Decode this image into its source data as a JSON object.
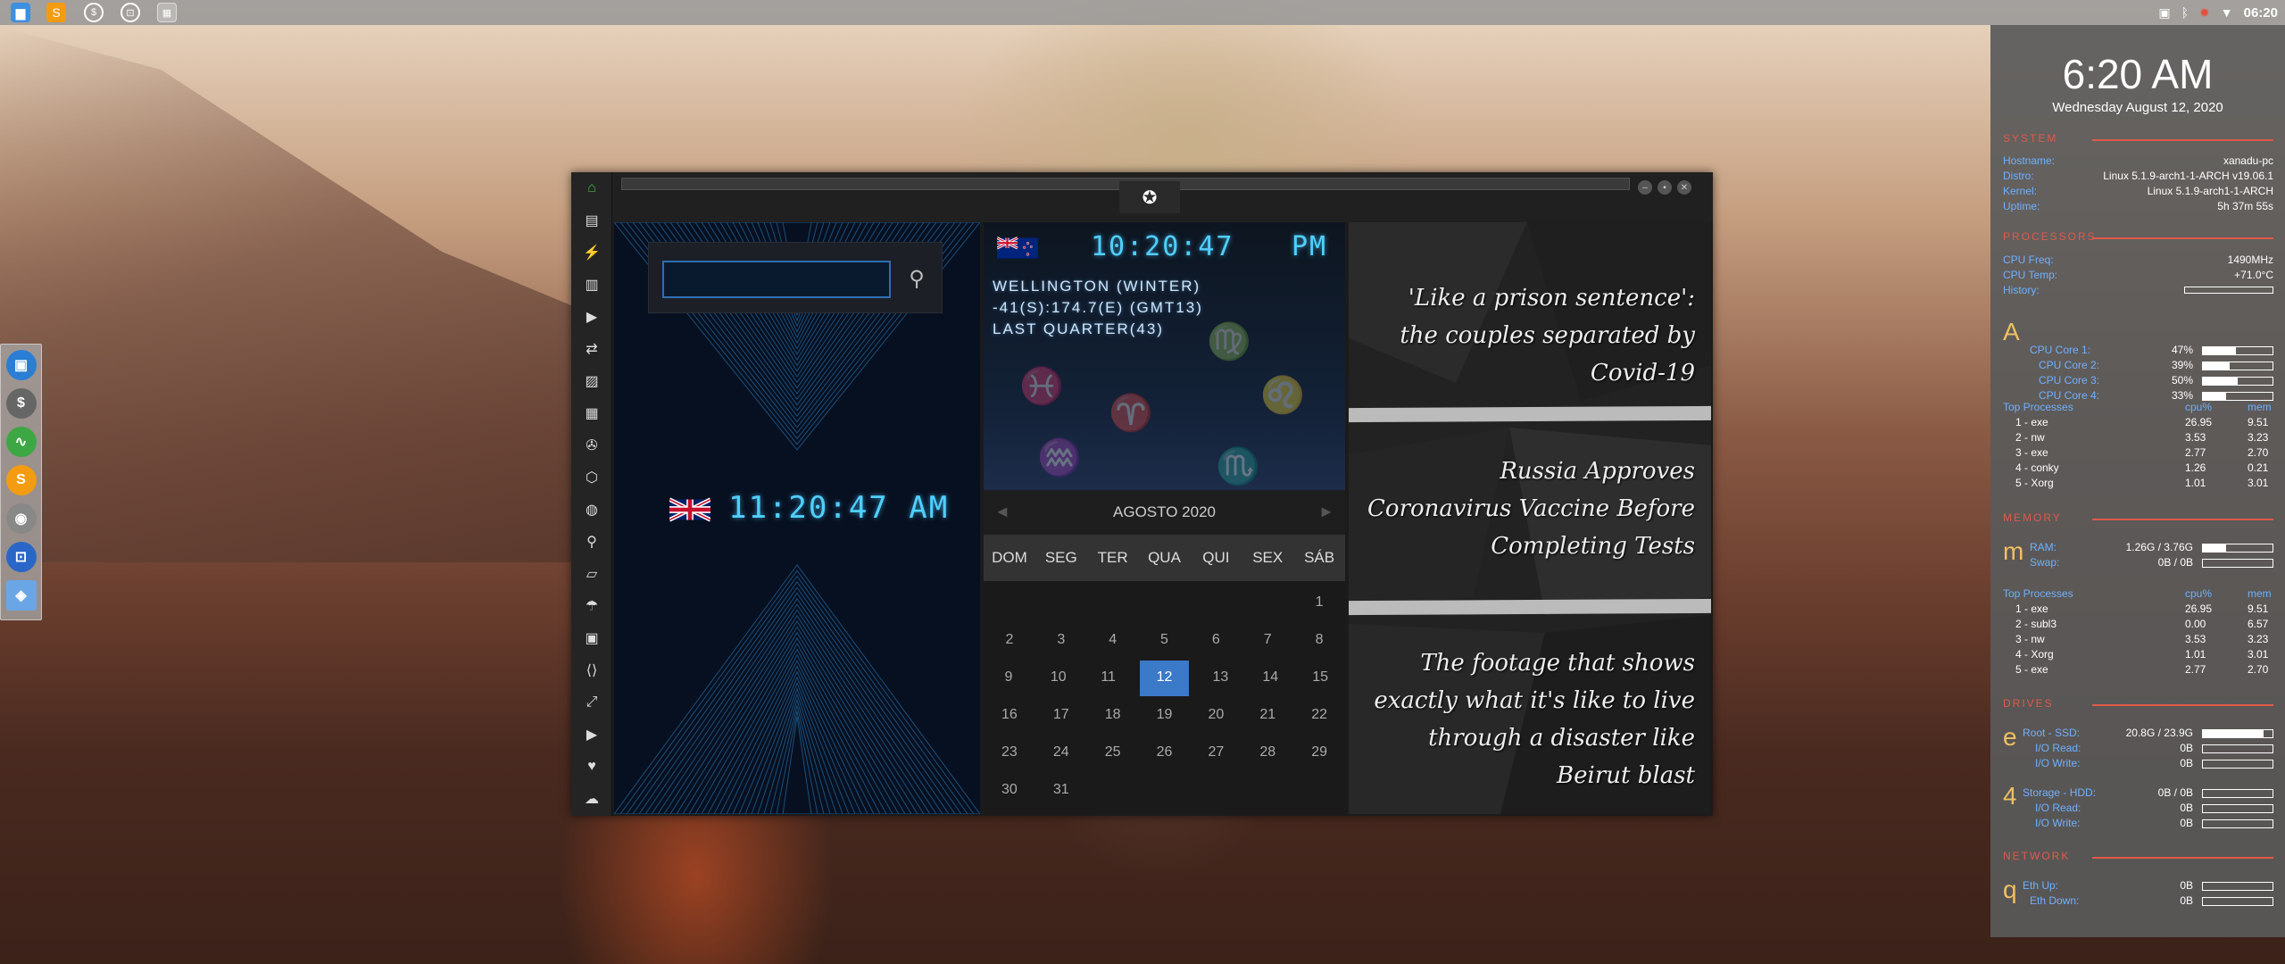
{
  "taskbar": {
    "clock": "06:20",
    "launchers": [
      "folder-icon",
      "sublime-icon",
      "money-icon",
      "remote-icon",
      "browser-thumb-icon"
    ],
    "tray_icons": [
      "photo-icon",
      "bluetooth-icon",
      "network-error-icon",
      "wifi-icon"
    ]
  },
  "dock": {
    "items": [
      {
        "name": "files-dock-icon",
        "glyph": "▣",
        "color": "#2a7fd4"
      },
      {
        "name": "money-dock-icon",
        "glyph": "$",
        "color": "#666"
      },
      {
        "name": "monitor-dock-icon",
        "glyph": "∿",
        "color": "#3da843"
      },
      {
        "name": "sublime-dock-icon",
        "glyph": "S",
        "color": "#f39c12"
      },
      {
        "name": "chrome-dock-icon",
        "glyph": "◉",
        "color": "#888"
      },
      {
        "name": "remote-dock-icon",
        "glyph": "⊡",
        "color": "#2a66c8"
      },
      {
        "name": "web-dock-icon",
        "glyph": "◈",
        "color": "#6aa6e6"
      }
    ]
  },
  "sidebar": {
    "items": [
      "home-icon",
      "document-icon",
      "lightning-icon",
      "archive-icon",
      "play-icon",
      "translate-icon",
      "image-icon",
      "news-icon",
      "aperture-icon",
      "hexagon-icon",
      "globe-icon",
      "search-icon",
      "map-icon",
      "umbrella-icon",
      "contact-icon",
      "code-icon",
      "expand-icon",
      "youtube-icon",
      "heart-icon",
      "cloud-icon"
    ]
  },
  "world_clock": {
    "uk_time": "11:20:47 AM",
    "nz_time": "10:20:47",
    "nz_ampm": "PM",
    "nz_city": "WELLINGTON (WINTER)",
    "nz_coords": "-41(S):174.7(E) (GMT13)",
    "nz_moon": "LAST QUARTER(43)"
  },
  "calendar": {
    "month_title": "AGOSTO 2020",
    "days_of_week": [
      "DOM",
      "SEG",
      "TER",
      "QUA",
      "QUI",
      "SEX",
      "SÁB"
    ],
    "weeks": [
      [
        "",
        "",
        "",
        "",
        "",
        "",
        "1"
      ],
      [
        "2",
        "3",
        "4",
        "5",
        "6",
        "7",
        "8"
      ],
      [
        "9",
        "10",
        "11",
        "12",
        "13",
        "14",
        "15"
      ],
      [
        "16",
        "17",
        "18",
        "19",
        "20",
        "21",
        "22"
      ],
      [
        "23",
        "24",
        "25",
        "26",
        "27",
        "28",
        "29"
      ],
      [
        "30",
        "31",
        "",
        "",
        "",
        "",
        ""
      ]
    ],
    "today": "12"
  },
  "news": [
    "'Like a prison sentence': the couples separated by Covid-19",
    "Russia Approves Coronavirus Vaccine Before Completing Tests",
    "The footage that shows exactly what it's like to live through a disaster like Beirut blast"
  ],
  "conky": {
    "time": "6:20 AM",
    "date": "Wednesday August 12, 2020",
    "system_title": "SYSTEM",
    "hostname_label": "Hostname:",
    "hostname": "xanadu-pc",
    "distro_label": "Distro:",
    "distro": "Linux 5.1.9-arch1-1-ARCH v19.06.1",
    "kernel_label": "Kernel:",
    "kernel": "Linux 5.1.9-arch1-1-ARCH",
    "uptime_label": "Uptime:",
    "uptime": "5h 37m 55s",
    "proc_title": "PROCESSORS",
    "cpu_freq_label": "CPU Freq:",
    "cpu_freq": "1490MHz",
    "cpu_temp_label": "CPU Temp:",
    "cpu_temp": "+71.0°C",
    "history_label": "History:",
    "cpu_glyph": "A",
    "cores": [
      {
        "label": "CPU Core 1:",
        "value": "47%",
        "pct": 0.47
      },
      {
        "label": "CPU Core 2:",
        "value": "39%",
        "pct": 0.39
      },
      {
        "label": "CPU Core 3:",
        "value": "50%",
        "pct": 0.5
      },
      {
        "label": "CPU Core 4:",
        "value": "33%",
        "pct": 0.33
      }
    ],
    "top_label": "Top Processes",
    "cpu_col": "cpu%",
    "mem_col": "mem",
    "top_cpu": [
      [
        "1 - exe",
        "26.95",
        "9.51"
      ],
      [
        "2 - nw",
        "3.53",
        "3.23"
      ],
      [
        "3 - exe",
        "2.77",
        "2.70"
      ],
      [
        "4 - conky",
        "1.26",
        "0.21"
      ],
      [
        "5 - Xorg",
        "1.01",
        "3.01"
      ]
    ],
    "mem_title": "MEMORY",
    "mem_glyph": "m",
    "ram_label": "RAM:",
    "ram": "1.26G / 3.76G",
    "ram_pct": 0.33,
    "swap_label": "Swap:",
    "swap": "0B / 0B",
    "swap_pct": 0,
    "top_mem": [
      [
        "1 - exe",
        "26.95",
        "9.51"
      ],
      [
        "2 - subl3",
        "0.00",
        "6.57"
      ],
      [
        "3 - nw",
        "3.53",
        "3.23"
      ],
      [
        "4 - Xorg",
        "1.01",
        "3.01"
      ],
      [
        "5 - exe",
        "2.77",
        "2.70"
      ]
    ],
    "drives_title": "DRIVES",
    "root_glyph": "e",
    "root_label": "Root - SSD:",
    "root": "20.8G / 23.9G",
    "root_pct": 0.87,
    "io_read_label": "I/O Read:",
    "io_read": "0B",
    "io_write_label": "I/O Write:",
    "io_write": "0B",
    "storage_glyph": "4",
    "storage_label": "Storage - HDD:",
    "storage": "0B / 0B",
    "io_read2": "0B",
    "io_write2": "0B",
    "net_title": "NETWORK",
    "net_glyph": "q",
    "eth_up_label": "Eth Up:",
    "eth_up": "0B",
    "eth_down_label": "Eth Down:",
    "eth_down": "0B"
  }
}
